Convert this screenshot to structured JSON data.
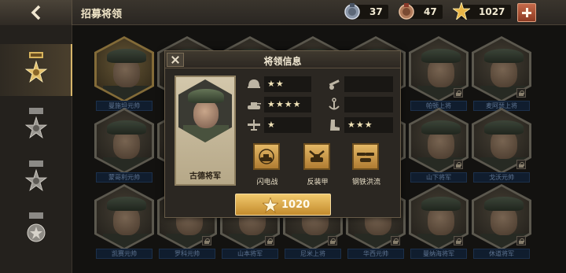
{
  "header": {
    "title": "招募将领",
    "resources": [
      {
        "icon": "medal-silver-icon",
        "value": "37"
      },
      {
        "icon": "medal-bronze-icon",
        "value": "47"
      },
      {
        "icon": "gold-star-icon",
        "value": "1027"
      }
    ]
  },
  "sidebar": {
    "tabs": [
      {
        "icon": "gold-rank-badge-icon",
        "active": true
      },
      {
        "icon": "silver-rank-badge-icon",
        "active": false
      },
      {
        "icon": "silver-rank-badge-icon",
        "active": false
      },
      {
        "icon": "star-rank-badge-icon",
        "active": false
      }
    ]
  },
  "roster": [
    {
      "name": "曼施坦元帅",
      "gold": true,
      "locked": false
    },
    {
      "name": "",
      "gold": false,
      "locked": false
    },
    {
      "name": "",
      "gold": false,
      "locked": false
    },
    {
      "name": "",
      "gold": false,
      "locked": false
    },
    {
      "name": "",
      "gold": false,
      "locked": false
    },
    {
      "name": "帕顿上将",
      "gold": false,
      "locked": true
    },
    {
      "name": "麦阿瑟上将",
      "gold": false,
      "locked": true
    },
    {
      "name": "蒙哥利元帅",
      "gold": false,
      "locked": false
    },
    {
      "name": "",
      "gold": false,
      "locked": false
    },
    {
      "name": "",
      "gold": false,
      "locked": false
    },
    {
      "name": "",
      "gold": false,
      "locked": false
    },
    {
      "name": "",
      "gold": false,
      "locked": false
    },
    {
      "name": "山下将军",
      "gold": false,
      "locked": true
    },
    {
      "name": "戈沃元帅",
      "gold": false,
      "locked": true
    },
    {
      "name": "凯赛元帅",
      "gold": false,
      "locked": false
    },
    {
      "name": "罗科元帅",
      "gold": false,
      "locked": true
    },
    {
      "name": "山本将军",
      "gold": false,
      "locked": true
    },
    {
      "name": "尼米上将",
      "gold": false,
      "locked": true
    },
    {
      "name": "华西元帅",
      "gold": false,
      "locked": true
    },
    {
      "name": "曼纳海将军",
      "gold": false,
      "locked": true
    },
    {
      "name": "休道将军",
      "gold": false,
      "locked": true
    }
  ],
  "modal": {
    "title": "将领信息",
    "general_name": "古德将军",
    "stats": [
      {
        "icon": "infantry-helmet-icon",
        "stars": "★★"
      },
      {
        "icon": "artillery-cannon-icon",
        "stars": ""
      },
      {
        "icon": "tank-icon",
        "stars": "★★★★"
      },
      {
        "icon": "navy-anchor-icon",
        "stars": ""
      },
      {
        "icon": "aircraft-icon",
        "stars": "★"
      },
      {
        "icon": "supply-boot-icon",
        "stars": "★★★"
      }
    ],
    "skills": [
      {
        "icon": "blitz-tank-skill-icon",
        "label": "闪电战"
      },
      {
        "icon": "anti-armor-skill-icon",
        "label": "反装甲"
      },
      {
        "icon": "steel-flood-skill-icon",
        "label": "钢铁洪流"
      }
    ],
    "price": "1020"
  },
  "colors": {
    "gold": "#d7b56a",
    "panel": "#2b2722",
    "nameplate": "#1a2d47"
  }
}
